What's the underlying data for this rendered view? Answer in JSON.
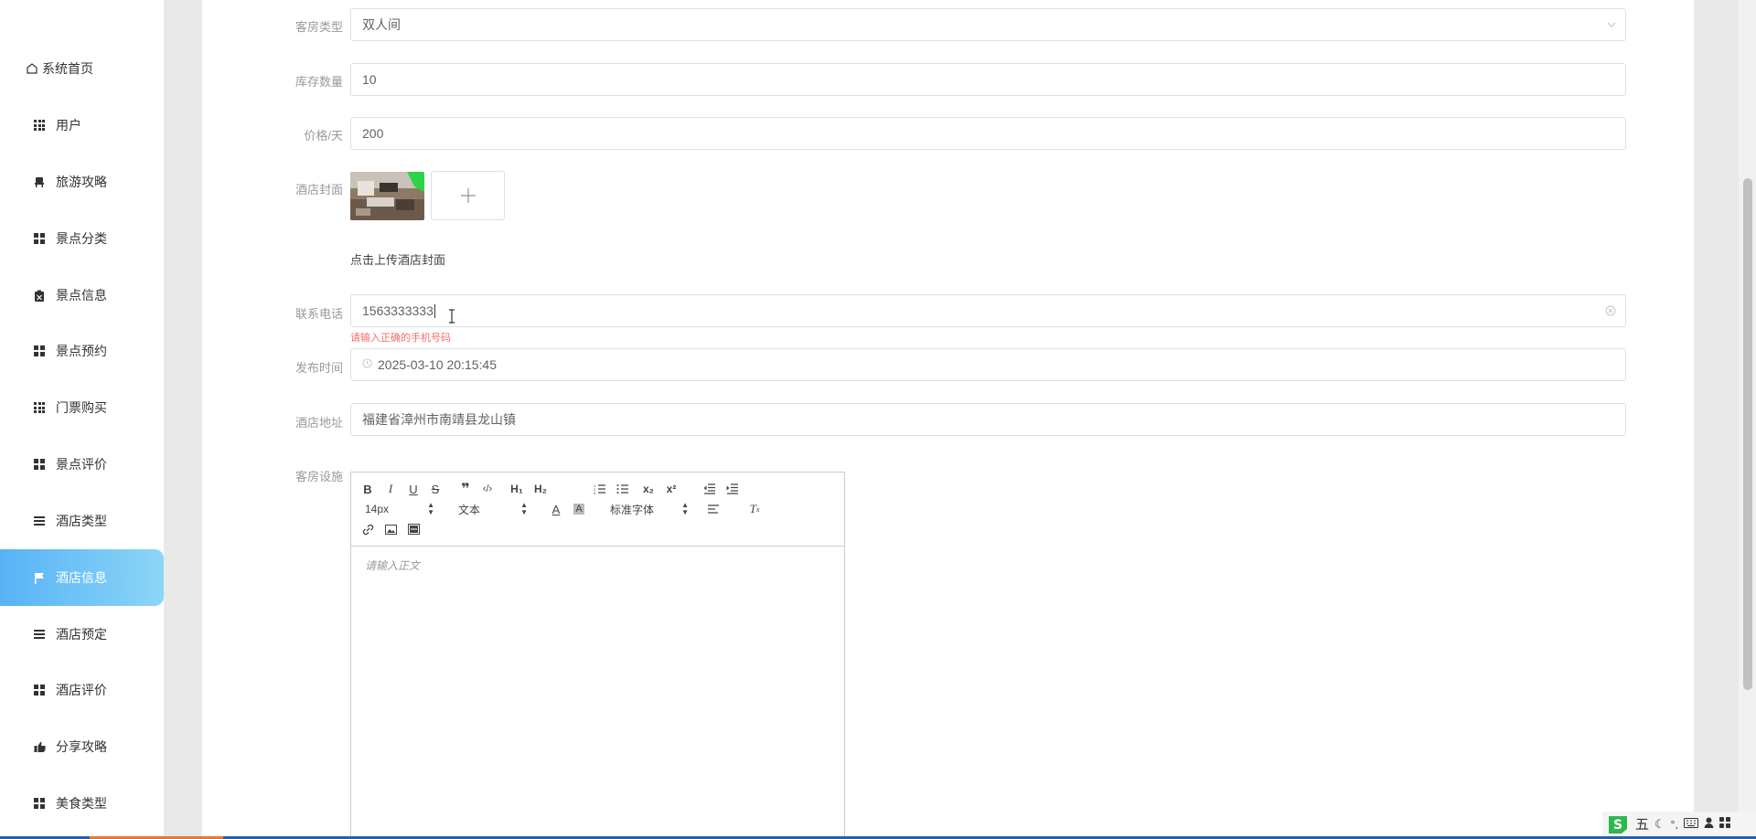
{
  "sidebar": {
    "items": [
      {
        "label": "系统首页",
        "icon": "home-icon"
      },
      {
        "label": "用户",
        "icon": "grid-icon"
      },
      {
        "label": "旅游攻略",
        "icon": "chair-icon"
      },
      {
        "label": "景点分类",
        "icon": "apps-icon"
      },
      {
        "label": "景点信息",
        "icon": "clipboard-icon"
      },
      {
        "label": "景点预约",
        "icon": "apps-icon"
      },
      {
        "label": "门票购买",
        "icon": "grid-icon"
      },
      {
        "label": "景点评价",
        "icon": "apps-icon"
      },
      {
        "label": "酒店类型",
        "icon": "list-icon"
      },
      {
        "label": "酒店信息",
        "icon": "flag-icon",
        "active": true
      },
      {
        "label": "酒店预定",
        "icon": "list-icon"
      },
      {
        "label": "酒店评价",
        "icon": "apps-icon"
      },
      {
        "label": "分享攻略",
        "icon": "thumb-icon"
      },
      {
        "label": "美食类型",
        "icon": "apps-icon"
      }
    ]
  },
  "form": {
    "room_type": {
      "label": "客房类型",
      "value": "双人间"
    },
    "stock": {
      "label": "库存数量",
      "value": "10"
    },
    "price": {
      "label": "价格/天",
      "value": "200"
    },
    "cover": {
      "label": "酒店封面",
      "hint": "点击上传酒店封面"
    },
    "phone": {
      "label": "联系电话",
      "value": "1563333333",
      "error": "请输入正确的手机号码"
    },
    "publish_time": {
      "label": "发布时间",
      "value": "2025-03-10 20:15:45"
    },
    "address": {
      "label": "酒店地址",
      "value": "福建省漳州市南靖县龙山镇"
    },
    "facilities": {
      "label": "客房设施",
      "placeholder": "请输入正文"
    }
  },
  "editor": {
    "font_size": "14px",
    "block": "文本",
    "font_family": "标准字体"
  },
  "ime": {
    "logo_text": "S",
    "mode": "五"
  },
  "colors": {
    "accent": "#57b2f5",
    "error": "#f56c6c",
    "border": "#dcdfe6"
  }
}
